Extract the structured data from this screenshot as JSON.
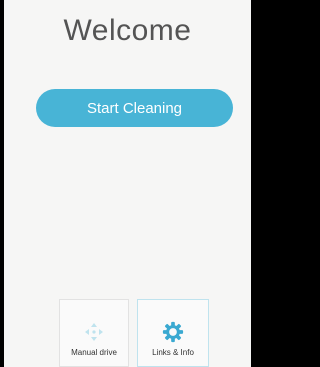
{
  "header": {
    "title": "Welcome"
  },
  "main": {
    "start_label": "Start Cleaning"
  },
  "bottom_nav": {
    "items": [
      {
        "label": "Manual drive",
        "icon": "directional-pad-icon"
      },
      {
        "label": "Links & Info",
        "icon": "gear-icon"
      }
    ]
  },
  "colors": {
    "accent": "#48b4d6",
    "background": "#f6f6f5",
    "title_text": "#545454",
    "dpad_muted": "#bfe3ee"
  }
}
